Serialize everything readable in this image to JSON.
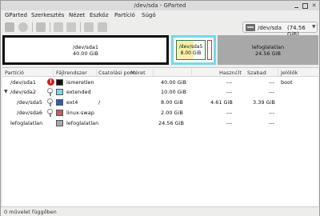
{
  "window": {
    "title": "/dev/sda - GParted"
  },
  "menu": [
    "GParted",
    "Szerkesztés",
    "Nézet",
    "Eszköz",
    "Partíció",
    "Súgó"
  ],
  "device": {
    "name": "/dev/sda",
    "size": "(74.56 GiB)"
  },
  "graph": {
    "sda1": {
      "name": "/dev/sda1",
      "size": "40.00 GiB"
    },
    "sda5": {
      "name": "/dev/sda5",
      "size": "8.00 GiB"
    },
    "unallocated": {
      "name": "lefoglalatlan",
      "size": "24.56 GiB"
    }
  },
  "columns": [
    "Partíció",
    "Fájlrendszer",
    "Csatolási pont",
    "Méret",
    "Használt",
    "Szabad",
    "Jelölők"
  ],
  "rows": [
    {
      "partition": "/dev/sda1",
      "filesystem": "ismeretlen",
      "mount": "",
      "size": "40.00 GiB",
      "used": "---",
      "free": "---",
      "flags": "boot",
      "color": "#111111"
    },
    {
      "partition": "/dev/sda2",
      "filesystem": "extended",
      "mount": "",
      "size": "10.00 GiB",
      "used": "---",
      "free": "---",
      "flags": "",
      "color": "#7ad7e6"
    },
    {
      "partition": "/dev/sda5",
      "filesystem": "ext4",
      "mount": "/",
      "size": "8.00 GiB",
      "used": "4.61 GiB",
      "free": "3.39 GiB",
      "flags": "",
      "color": "#2f5fa8"
    },
    {
      "partition": "/dev/sda6",
      "filesystem": "linux-swap",
      "mount": "",
      "size": "2.00 GiB",
      "used": "---",
      "free": "---",
      "flags": "",
      "color": "#c06060"
    },
    {
      "partition": "lefoglalatlan",
      "filesystem": "lefoglalatlan",
      "mount": "",
      "size": "24.56 GiB",
      "used": "---",
      "free": "---",
      "flags": "",
      "color": "#a8a8a8"
    }
  ],
  "status": "0 művelet függőben"
}
